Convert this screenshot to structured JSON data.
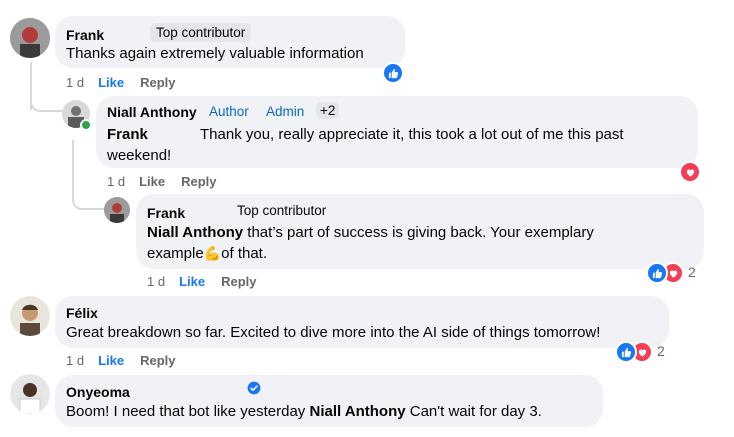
{
  "comments": [
    {
      "author": "Frank",
      "badge": "Top contributor",
      "text": "Thanks again extremely valuable information",
      "time": "1 d",
      "like": "Like",
      "reply": "Reply"
    },
    {
      "author": "Niall Anthony",
      "badges": [
        "Author",
        "Admin",
        "+2"
      ],
      "mention": "Frank",
      "text_line1": "Thank you, really appreciate it, this took a lot out of me this past",
      "text_line2": "weekend!",
      "time": "1 d",
      "like": "Like",
      "reply": "Reply"
    },
    {
      "author": "Frank",
      "badge": "Top contributor",
      "mention": "Niall Anthony",
      "text_line1": " that’s part of success is giving back. Your exemplary",
      "text_line2a": "example",
      "emoji": "💪",
      "text_line2b": "of that.",
      "time": "1 d",
      "like": "Like",
      "reply": "Reply",
      "reaction_count": "2"
    },
    {
      "author": "Félix",
      "text": "Great breakdown so far. Excited to dive more into the AI side of things tomorrow!",
      "time": "1 d",
      "like": "Like",
      "reply": "Reply",
      "reaction_count": "2"
    },
    {
      "author": "Onyeoma",
      "text_a": "Boom! I need that bot like yesterday ",
      "mention": "Niall Anthony",
      "text_b": " Can't wait for day 3."
    }
  ],
  "colors": {
    "bubble": "#f0f2f5",
    "like_blue": "#1877f2",
    "love_red": "#f33e58",
    "meta_grey": "#65676b"
  },
  "icons": [
    "like-reaction-icon",
    "love-reaction-icon",
    "verified-badge-icon",
    "online-status-icon"
  ]
}
